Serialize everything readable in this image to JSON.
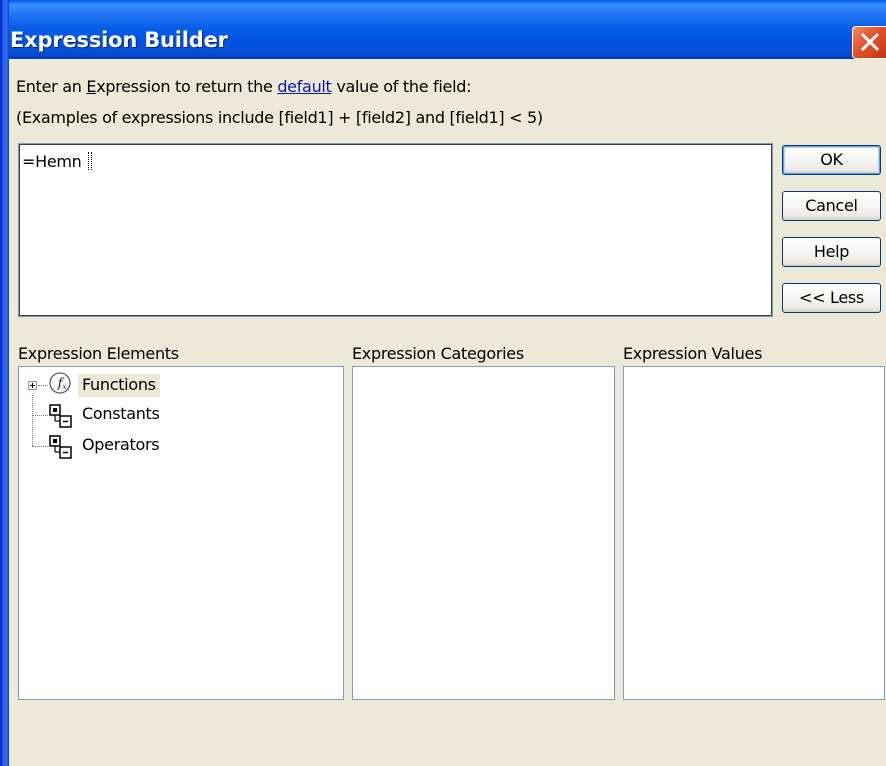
{
  "window": {
    "title": "Expression Builder"
  },
  "instructions": {
    "line1_before": "Enter an ",
    "line1_underlined_letter": "E",
    "line1_mid": "xpression to return the ",
    "line1_link": "default",
    "line1_after": " value of the field:",
    "line2": "(Examples of expressions include [field1] + [field2] and [field1] < 5)"
  },
  "expression": {
    "value": "=Hemn "
  },
  "buttons": {
    "ok": "OK",
    "cancel": "Cancel",
    "help": "Help",
    "less": "<< Less"
  },
  "panes": {
    "elements_label": "Expression Elements",
    "categories_label": "Expression Categories",
    "values_label": "Expression Values",
    "elements": [
      {
        "label": "Functions",
        "icon": "function-icon",
        "expandable": true,
        "selected": true
      },
      {
        "label": "Constants",
        "icon": "element-group-icon",
        "expandable": false,
        "selected": false
      },
      {
        "label": "Operators",
        "icon": "element-group-icon",
        "expandable": false,
        "selected": false
      }
    ]
  },
  "colors": {
    "title_bar": "#0054e3",
    "dialog_face": "#ece9d8",
    "close_button": "#e3502d",
    "link": "#0a1aa8",
    "field_border": "#7f9db9"
  }
}
